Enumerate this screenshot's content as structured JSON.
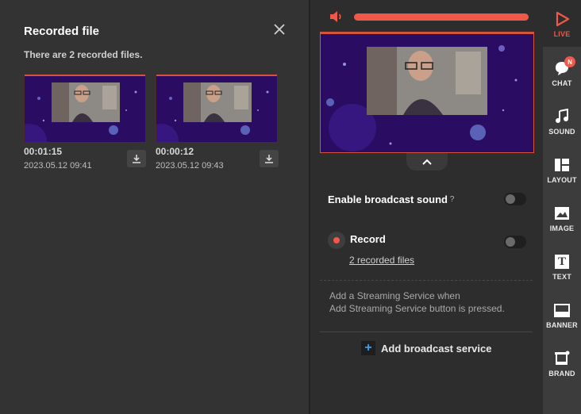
{
  "recorded": {
    "title": "Recorded file",
    "count_text": "There are 2 recorded files.",
    "files": [
      {
        "duration": "00:01:15",
        "date": "2023.05.12 09:41"
      },
      {
        "duration": "00:00:12",
        "date": "2023.05.12 09:43"
      }
    ]
  },
  "settings": {
    "volume_level": 1.0,
    "broadcast_sound_label": "Enable broadcast sound",
    "help_label": "?",
    "broadcast_sound_enabled": false,
    "record_label": "Record",
    "record_enabled": false,
    "recorded_files_link": "2 recorded files",
    "info_line1": "Add a Streaming Service when",
    "info_line2": "Add Streaming Service button is pressed.",
    "add_service_label": "Add broadcast service"
  },
  "toolbar": {
    "live": "LIVE",
    "chat": "CHAT",
    "chat_badge": "N",
    "sound": "SOUND",
    "layout": "LAYOUT",
    "image": "IMAGE",
    "text": "TEXT",
    "text_glyph": "T",
    "banner": "BANNER",
    "brand": "BRAND"
  },
  "colors": {
    "accent": "#f0584a",
    "plus": "#3aa0f0",
    "video_bg": "#2a0d63"
  }
}
